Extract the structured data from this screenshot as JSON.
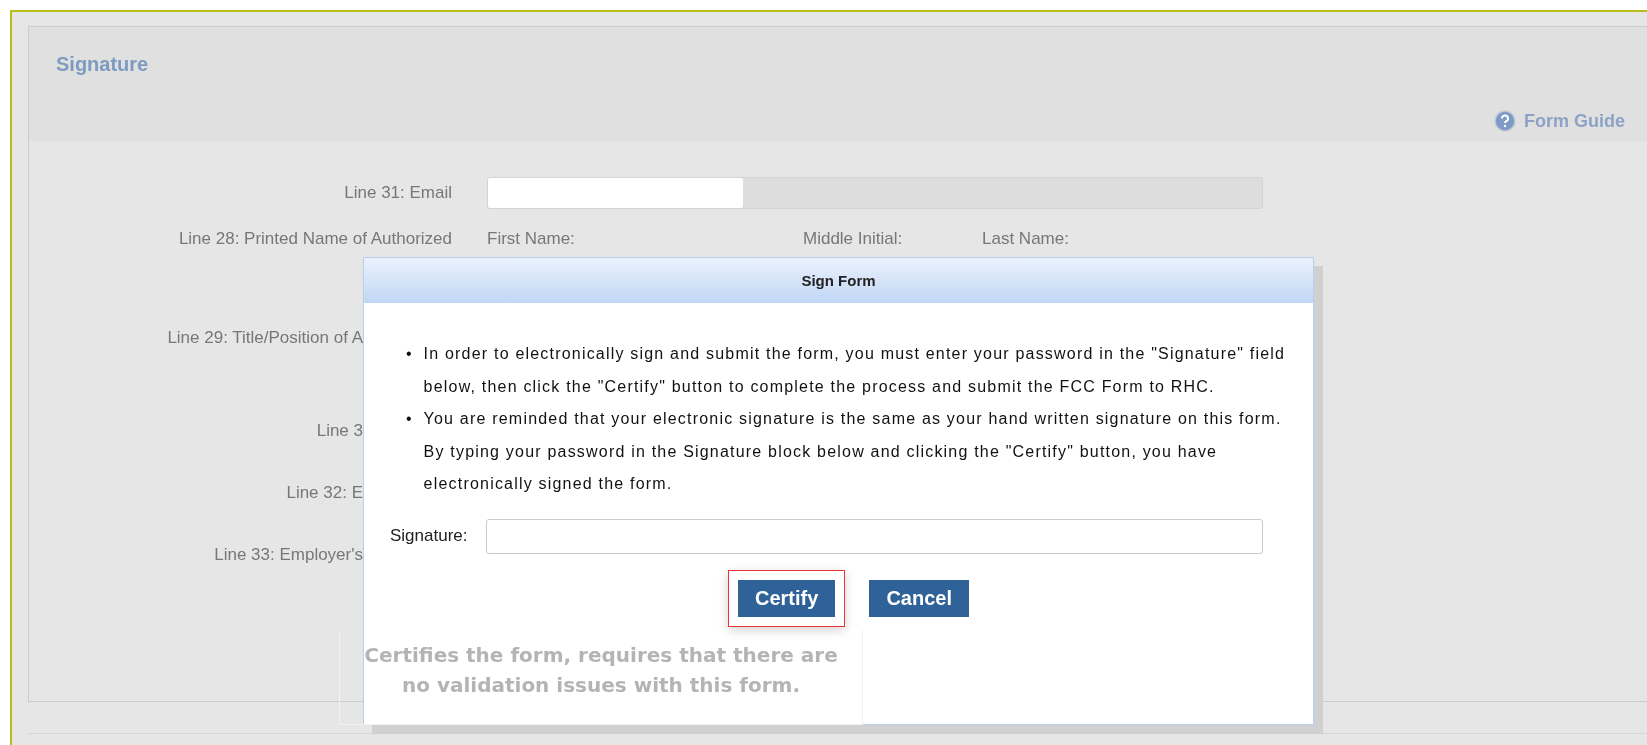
{
  "panel": {
    "title": "Signature",
    "form_guide": "Form Guide"
  },
  "fields": [
    {
      "kind": "input",
      "label": "Line 31: Email"
    },
    {
      "kind": "names",
      "label": "Line 28: Printed Name of Authorized",
      "parts": [
        "First Name:",
        "Middle Initial:",
        "Last Name:"
      ]
    },
    {
      "kind": "covered",
      "label": "Line 29: Title/Position of A"
    },
    {
      "kind": "covered",
      "label": "Line 3"
    },
    {
      "kind": "covered",
      "label": "Line 32: E"
    },
    {
      "kind": "covered",
      "label": "Line 33: Employer's"
    }
  ],
  "dialog": {
    "title": "Sign Form",
    "bullet_marker": "•",
    "bullets": [
      "In order to electronically sign and submit the form, you must enter your password in the \"Signature\" field below, then click the \"Certify\" button to complete the process and submit the FCC Form to RHC.",
      "You are reminded that your electronic signature is the same as your hand written signature on this form. By typing your password in the Signature block below and clicking the \"Certify\" button, you have electronically signed the form."
    ],
    "signature_label": "Signature:",
    "buttons": [
      {
        "label": "Certify",
        "highlighted": true
      },
      {
        "label": "Cancel",
        "highlighted": false
      }
    ],
    "tooltip": "Certifies the form, requires that there are no validation issues with this form."
  }
}
